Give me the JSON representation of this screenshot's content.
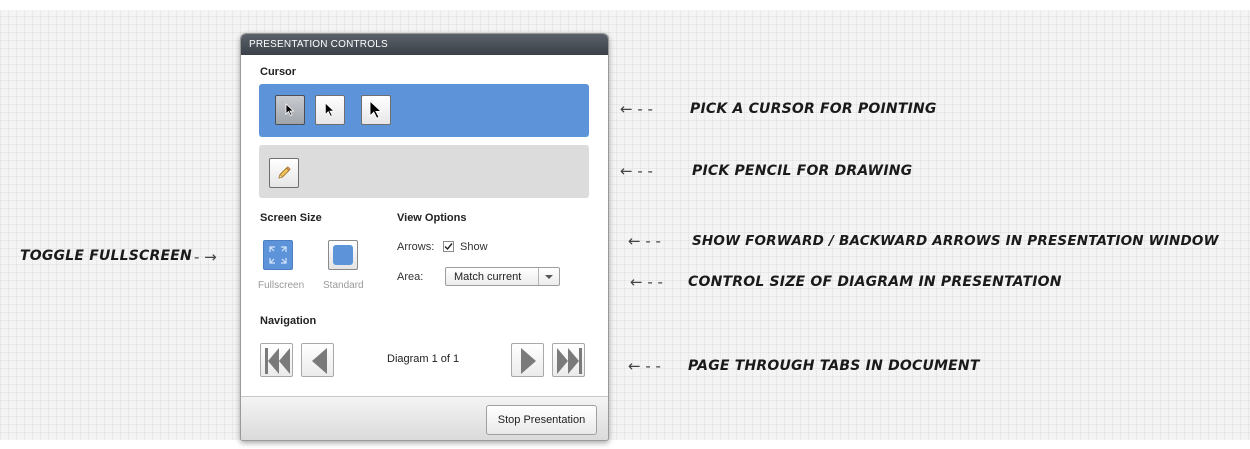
{
  "panel": {
    "title": "PRESENTATION CONTROLS",
    "cursor_section": "Cursor",
    "screen_size": {
      "title": "Screen Size",
      "fullscreen_label": "Fullscreen",
      "standard_label": "Standard"
    },
    "view_options": {
      "title": "View Options",
      "arrows_label": "Arrows:",
      "show_label": "Show",
      "show_checked": true,
      "area_label": "Area:",
      "area_value": "Match current"
    },
    "navigation": {
      "title": "Navigation",
      "diagram_count": "Diagram 1 of 1"
    },
    "stop_button": "Stop Presentation"
  },
  "annotations": {
    "cursor": "PICK A CURSOR FOR POINTING",
    "pencil": "PICK PENCIL FOR DRAWING",
    "arrows": "SHOW FORWARD / BACKWARD ARROWS IN PRESENTATION WINDOW",
    "area": "CONTROL SIZE OF DIAGRAM IN PRESENTATION",
    "nav": "PAGE THROUGH TABS IN DOCUMENT",
    "fullscreen": "TOGGLE FULLSCREEN",
    "arrow_left": "← - -",
    "arrow_right": "- →"
  },
  "colors": {
    "accent": "#5d93d9",
    "header": "#3b4148",
    "tool_box_grey": "#dcdcdc"
  },
  "icons": [
    "cursor-small-icon",
    "cursor-medium-icon",
    "cursor-large-icon",
    "pencil-icon",
    "fullscreen-icon",
    "standard-screen-icon",
    "checkbox-icon",
    "dropdown-arrow-icon",
    "first-page-icon",
    "previous-page-icon",
    "next-page-icon",
    "last-page-icon"
  ]
}
